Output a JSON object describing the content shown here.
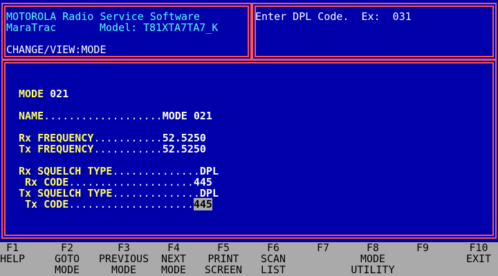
{
  "header": {
    "app_title": "MOTOROLA Radio Service Software",
    "product": "MaraTrac",
    "model_label": "Model:",
    "model_value": "T81XTA7TA7_K",
    "screen_path": "CHANGE/VIEW:MODE",
    "prompt": "Enter DPL Code.  Ex:  031"
  },
  "main": {
    "heading_label": "MODE",
    "heading_value": "021",
    "fields": [
      {
        "label": "NAME",
        "dots": "...................",
        "value": "MODE 021"
      },
      {
        "label": "Rx FREQUENCY",
        "dots": "...........",
        "value": "52.5250"
      },
      {
        "label": "Tx FREQUENCY",
        "dots": "...........",
        "value": "52.5250"
      },
      {
        "label": "Rx SQUELCH TYPE",
        "dots": "..............",
        "value": "DPL"
      },
      {
        "label": " Rx CODE",
        "dots": "....................",
        "value": "445"
      },
      {
        "label": "Tx SQUELCH TYPE",
        "dots": "..............",
        "value": "DPL"
      },
      {
        "label": " Tx CODE",
        "dots": "....................",
        "value": "445"
      }
    ]
  },
  "function_keys": [
    {
      "key": "F1",
      "line1": "HELP",
      "line2": ""
    },
    {
      "key": "F2",
      "line1": "GOTO",
      "line2": "MODE"
    },
    {
      "key": "F3",
      "line1": "PREVIOUS",
      "line2": "MODE"
    },
    {
      "key": "F4",
      "line1": "NEXT",
      "line2": "MODE"
    },
    {
      "key": "F5",
      "line1": "PRINT",
      "line2": "SCREEN"
    },
    {
      "key": "F6",
      "line1": "SCAN",
      "line2": "LIST"
    },
    {
      "key": "F7",
      "line1": "",
      "line2": ""
    },
    {
      "key": "F8",
      "line1": "MODE",
      "line2": "UTILITY"
    },
    {
      "key": "F9",
      "line1": "",
      "line2": ""
    },
    {
      "key": "F10",
      "line1": "EXIT",
      "line2": ""
    }
  ],
  "colors": {
    "background": "#0000aa",
    "border": "#ff5555",
    "label": "#ffff55",
    "header": "#55ffff",
    "bar": "#aaaaaa"
  }
}
